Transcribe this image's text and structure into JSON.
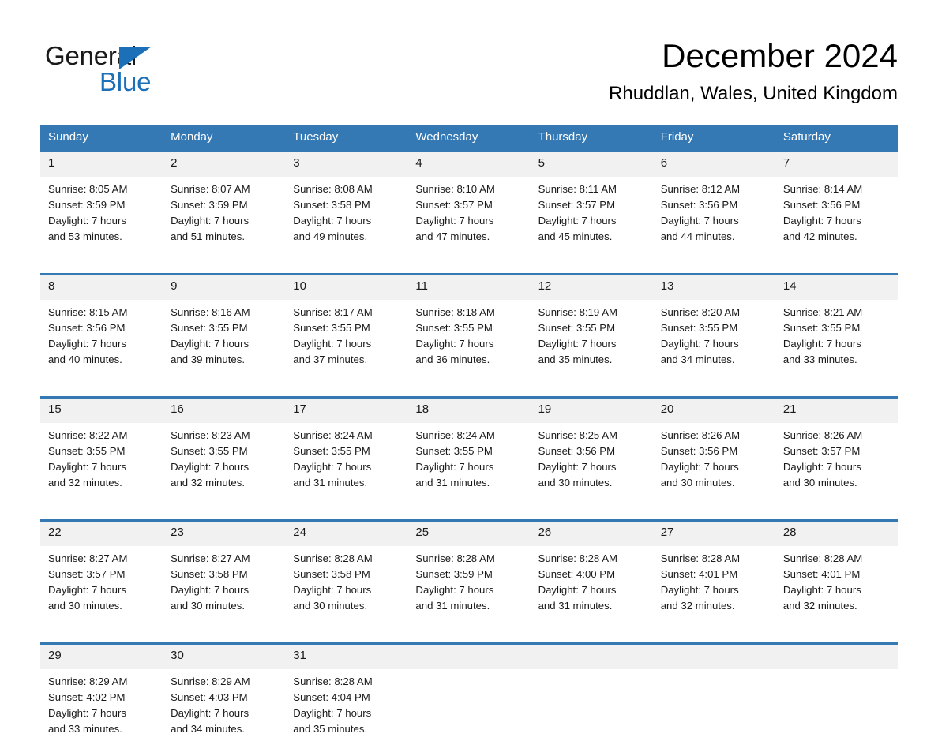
{
  "logo": {
    "general": "General",
    "blue": "Blue",
    "triangle_color": "#1b70b8"
  },
  "header": {
    "month_title": "December 2024",
    "location": "Rhuddlan, Wales, United Kingdom"
  },
  "colors": {
    "header_blue": "#3478b4",
    "day_band_gray": "#f1f1f1",
    "text": "#1a1a1a"
  },
  "weekday_headers": [
    "Sunday",
    "Monday",
    "Tuesday",
    "Wednesday",
    "Thursday",
    "Friday",
    "Saturday"
  ],
  "weeks": [
    {
      "days": [
        {
          "num": "1",
          "sunrise": "Sunrise: 8:05 AM",
          "sunset": "Sunset: 3:59 PM",
          "daylight_line1": "Daylight: 7 hours",
          "daylight_line2": "and 53 minutes."
        },
        {
          "num": "2",
          "sunrise": "Sunrise: 8:07 AM",
          "sunset": "Sunset: 3:59 PM",
          "daylight_line1": "Daylight: 7 hours",
          "daylight_line2": "and 51 minutes."
        },
        {
          "num": "3",
          "sunrise": "Sunrise: 8:08 AM",
          "sunset": "Sunset: 3:58 PM",
          "daylight_line1": "Daylight: 7 hours",
          "daylight_line2": "and 49 minutes."
        },
        {
          "num": "4",
          "sunrise": "Sunrise: 8:10 AM",
          "sunset": "Sunset: 3:57 PM",
          "daylight_line1": "Daylight: 7 hours",
          "daylight_line2": "and 47 minutes."
        },
        {
          "num": "5",
          "sunrise": "Sunrise: 8:11 AM",
          "sunset": "Sunset: 3:57 PM",
          "daylight_line1": "Daylight: 7 hours",
          "daylight_line2": "and 45 minutes."
        },
        {
          "num": "6",
          "sunrise": "Sunrise: 8:12 AM",
          "sunset": "Sunset: 3:56 PM",
          "daylight_line1": "Daylight: 7 hours",
          "daylight_line2": "and 44 minutes."
        },
        {
          "num": "7",
          "sunrise": "Sunrise: 8:14 AM",
          "sunset": "Sunset: 3:56 PM",
          "daylight_line1": "Daylight: 7 hours",
          "daylight_line2": "and 42 minutes."
        }
      ]
    },
    {
      "days": [
        {
          "num": "8",
          "sunrise": "Sunrise: 8:15 AM",
          "sunset": "Sunset: 3:56 PM",
          "daylight_line1": "Daylight: 7 hours",
          "daylight_line2": "and 40 minutes."
        },
        {
          "num": "9",
          "sunrise": "Sunrise: 8:16 AM",
          "sunset": "Sunset: 3:55 PM",
          "daylight_line1": "Daylight: 7 hours",
          "daylight_line2": "and 39 minutes."
        },
        {
          "num": "10",
          "sunrise": "Sunrise: 8:17 AM",
          "sunset": "Sunset: 3:55 PM",
          "daylight_line1": "Daylight: 7 hours",
          "daylight_line2": "and 37 minutes."
        },
        {
          "num": "11",
          "sunrise": "Sunrise: 8:18 AM",
          "sunset": "Sunset: 3:55 PM",
          "daylight_line1": "Daylight: 7 hours",
          "daylight_line2": "and 36 minutes."
        },
        {
          "num": "12",
          "sunrise": "Sunrise: 8:19 AM",
          "sunset": "Sunset: 3:55 PM",
          "daylight_line1": "Daylight: 7 hours",
          "daylight_line2": "and 35 minutes."
        },
        {
          "num": "13",
          "sunrise": "Sunrise: 8:20 AM",
          "sunset": "Sunset: 3:55 PM",
          "daylight_line1": "Daylight: 7 hours",
          "daylight_line2": "and 34 minutes."
        },
        {
          "num": "14",
          "sunrise": "Sunrise: 8:21 AM",
          "sunset": "Sunset: 3:55 PM",
          "daylight_line1": "Daylight: 7 hours",
          "daylight_line2": "and 33 minutes."
        }
      ]
    },
    {
      "days": [
        {
          "num": "15",
          "sunrise": "Sunrise: 8:22 AM",
          "sunset": "Sunset: 3:55 PM",
          "daylight_line1": "Daylight: 7 hours",
          "daylight_line2": "and 32 minutes."
        },
        {
          "num": "16",
          "sunrise": "Sunrise: 8:23 AM",
          "sunset": "Sunset: 3:55 PM",
          "daylight_line1": "Daylight: 7 hours",
          "daylight_line2": "and 32 minutes."
        },
        {
          "num": "17",
          "sunrise": "Sunrise: 8:24 AM",
          "sunset": "Sunset: 3:55 PM",
          "daylight_line1": "Daylight: 7 hours",
          "daylight_line2": "and 31 minutes."
        },
        {
          "num": "18",
          "sunrise": "Sunrise: 8:24 AM",
          "sunset": "Sunset: 3:55 PM",
          "daylight_line1": "Daylight: 7 hours",
          "daylight_line2": "and 31 minutes."
        },
        {
          "num": "19",
          "sunrise": "Sunrise: 8:25 AM",
          "sunset": "Sunset: 3:56 PM",
          "daylight_line1": "Daylight: 7 hours",
          "daylight_line2": "and 30 minutes."
        },
        {
          "num": "20",
          "sunrise": "Sunrise: 8:26 AM",
          "sunset": "Sunset: 3:56 PM",
          "daylight_line1": "Daylight: 7 hours",
          "daylight_line2": "and 30 minutes."
        },
        {
          "num": "21",
          "sunrise": "Sunrise: 8:26 AM",
          "sunset": "Sunset: 3:57 PM",
          "daylight_line1": "Daylight: 7 hours",
          "daylight_line2": "and 30 minutes."
        }
      ]
    },
    {
      "days": [
        {
          "num": "22",
          "sunrise": "Sunrise: 8:27 AM",
          "sunset": "Sunset: 3:57 PM",
          "daylight_line1": "Daylight: 7 hours",
          "daylight_line2": "and 30 minutes."
        },
        {
          "num": "23",
          "sunrise": "Sunrise: 8:27 AM",
          "sunset": "Sunset: 3:58 PM",
          "daylight_line1": "Daylight: 7 hours",
          "daylight_line2": "and 30 minutes."
        },
        {
          "num": "24",
          "sunrise": "Sunrise: 8:28 AM",
          "sunset": "Sunset: 3:58 PM",
          "daylight_line1": "Daylight: 7 hours",
          "daylight_line2": "and 30 minutes."
        },
        {
          "num": "25",
          "sunrise": "Sunrise: 8:28 AM",
          "sunset": "Sunset: 3:59 PM",
          "daylight_line1": "Daylight: 7 hours",
          "daylight_line2": "and 31 minutes."
        },
        {
          "num": "26",
          "sunrise": "Sunrise: 8:28 AM",
          "sunset": "Sunset: 4:00 PM",
          "daylight_line1": "Daylight: 7 hours",
          "daylight_line2": "and 31 minutes."
        },
        {
          "num": "27",
          "sunrise": "Sunrise: 8:28 AM",
          "sunset": "Sunset: 4:01 PM",
          "daylight_line1": "Daylight: 7 hours",
          "daylight_line2": "and 32 minutes."
        },
        {
          "num": "28",
          "sunrise": "Sunrise: 8:28 AM",
          "sunset": "Sunset: 4:01 PM",
          "daylight_line1": "Daylight: 7 hours",
          "daylight_line2": "and 32 minutes."
        }
      ]
    },
    {
      "days": [
        {
          "num": "29",
          "sunrise": "Sunrise: 8:29 AM",
          "sunset": "Sunset: 4:02 PM",
          "daylight_line1": "Daylight: 7 hours",
          "daylight_line2": "and 33 minutes."
        },
        {
          "num": "30",
          "sunrise": "Sunrise: 8:29 AM",
          "sunset": "Sunset: 4:03 PM",
          "daylight_line1": "Daylight: 7 hours",
          "daylight_line2": "and 34 minutes."
        },
        {
          "num": "31",
          "sunrise": "Sunrise: 8:28 AM",
          "sunset": "Sunset: 4:04 PM",
          "daylight_line1": "Daylight: 7 hours",
          "daylight_line2": "and 35 minutes."
        },
        {
          "num": "",
          "sunrise": "",
          "sunset": "",
          "daylight_line1": "",
          "daylight_line2": ""
        },
        {
          "num": "",
          "sunrise": "",
          "sunset": "",
          "daylight_line1": "",
          "daylight_line2": ""
        },
        {
          "num": "",
          "sunrise": "",
          "sunset": "",
          "daylight_line1": "",
          "daylight_line2": ""
        },
        {
          "num": "",
          "sunrise": "",
          "sunset": "",
          "daylight_line1": "",
          "daylight_line2": ""
        }
      ]
    }
  ]
}
